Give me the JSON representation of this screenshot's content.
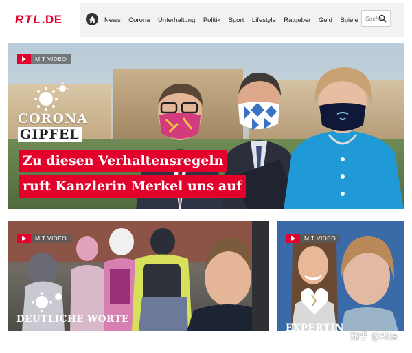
{
  "header": {
    "logo": {
      "brand": "RTL",
      "suffix": ".DE"
    },
    "nav": [
      "News",
      "Corona",
      "Unterhaltung",
      "Politik",
      "Sport",
      "Lifestyle",
      "Ratgeber",
      "Geld",
      "Spiele"
    ],
    "search": {
      "placeholder": "Suche"
    }
  },
  "hero": {
    "badge": "MIT VIDEO",
    "kicker_line1": "CORONA",
    "kicker_line2": "GIPFEL",
    "headline_line1": "Zu diesen Verhaltensregeln",
    "headline_line2": "ruft Kanzlerin Merkel uns auf"
  },
  "cards": [
    {
      "badge": "MIT VIDEO",
      "kicker": "DEUTLICHE WORTE"
    },
    {
      "badge": "MIT VIDEO",
      "kicker": "EXPERTIN"
    }
  ],
  "watermark": "知乎 @Rita",
  "colors": {
    "brand_red": "#e3002b",
    "header_bg": "#f2f2f2"
  }
}
